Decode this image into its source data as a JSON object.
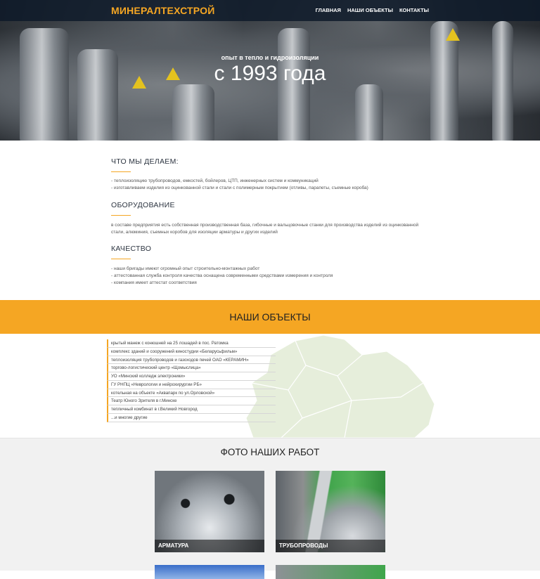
{
  "brand": "МИНЕРАЛТЕХСТРОЙ",
  "nav": [
    "ГЛАВНАЯ",
    "НАШИ ОБЪЕКТЫ",
    "КОНТАКТЫ"
  ],
  "hero": {
    "subtitle": "опыт в тепло и гидроизоляции",
    "title": "с 1993 года"
  },
  "sections": [
    {
      "title": "ЧТО МЫ ДЕЛАЕМ:",
      "lines": [
        "- теплоизоляцию трубопроводов, емкостей, бойлеров, ЦТП, инженерных систем и коммуникаций",
        "- изготавливаем изделия из оцинкованной стали и стали с полимерным покрытием (отливы, парапеты, съемные короба)"
      ]
    },
    {
      "title": "ОБОРУДОВАНИЕ",
      "lines": [
        "в составе предприятия есть собственная производственная база, гибочные и вальцовочные станки для производства изделий из оцинкованной",
        "стали, алюминия, съемных коробов для изоляции арматуры и других изделий"
      ]
    },
    {
      "title": "КАЧЕСТВО",
      "lines": [
        "- наши бригады имеют огромный опыт строительно-монтажных работ",
        "- аттестованная служба контроля качества оснащена современными средствами измерения и контроля",
        "- компания имеет аттестат соответствия"
      ]
    }
  ],
  "objects": {
    "heading": "НАШИ ОБЪЕКТЫ",
    "items": [
      "крытый манеж с конюшней на 25 лошадей в пос. Ратомка",
      "комплекс зданий и сооружений киностудии «Беларусьфильм»",
      "теплоизоляция трубопроводов и газоходов печей ОАО «КЕРАМИН»",
      "торгово-логистический центр «Щомыслица»",
      "УО «Минский колледж электроники»",
      "ГУ РНПЦ «Неврологии и нейрохирургии РБ»",
      "котельная на объекте «Аквапарк по ул.Орловской»",
      "Театр Юного Зрителя в г.Минске",
      "тепличный комбинат в г.Великий Новгород",
      "...и многие другие"
    ]
  },
  "photos": {
    "heading": "ФОТО НАШИХ РАБОТ",
    "cards": [
      "АРМАТУРА",
      "ТРУБОПРОВОДЫ"
    ]
  },
  "colors": {
    "accent": "#f5a623",
    "topbar": "#0c1828",
    "map": "#e6eedb"
  }
}
